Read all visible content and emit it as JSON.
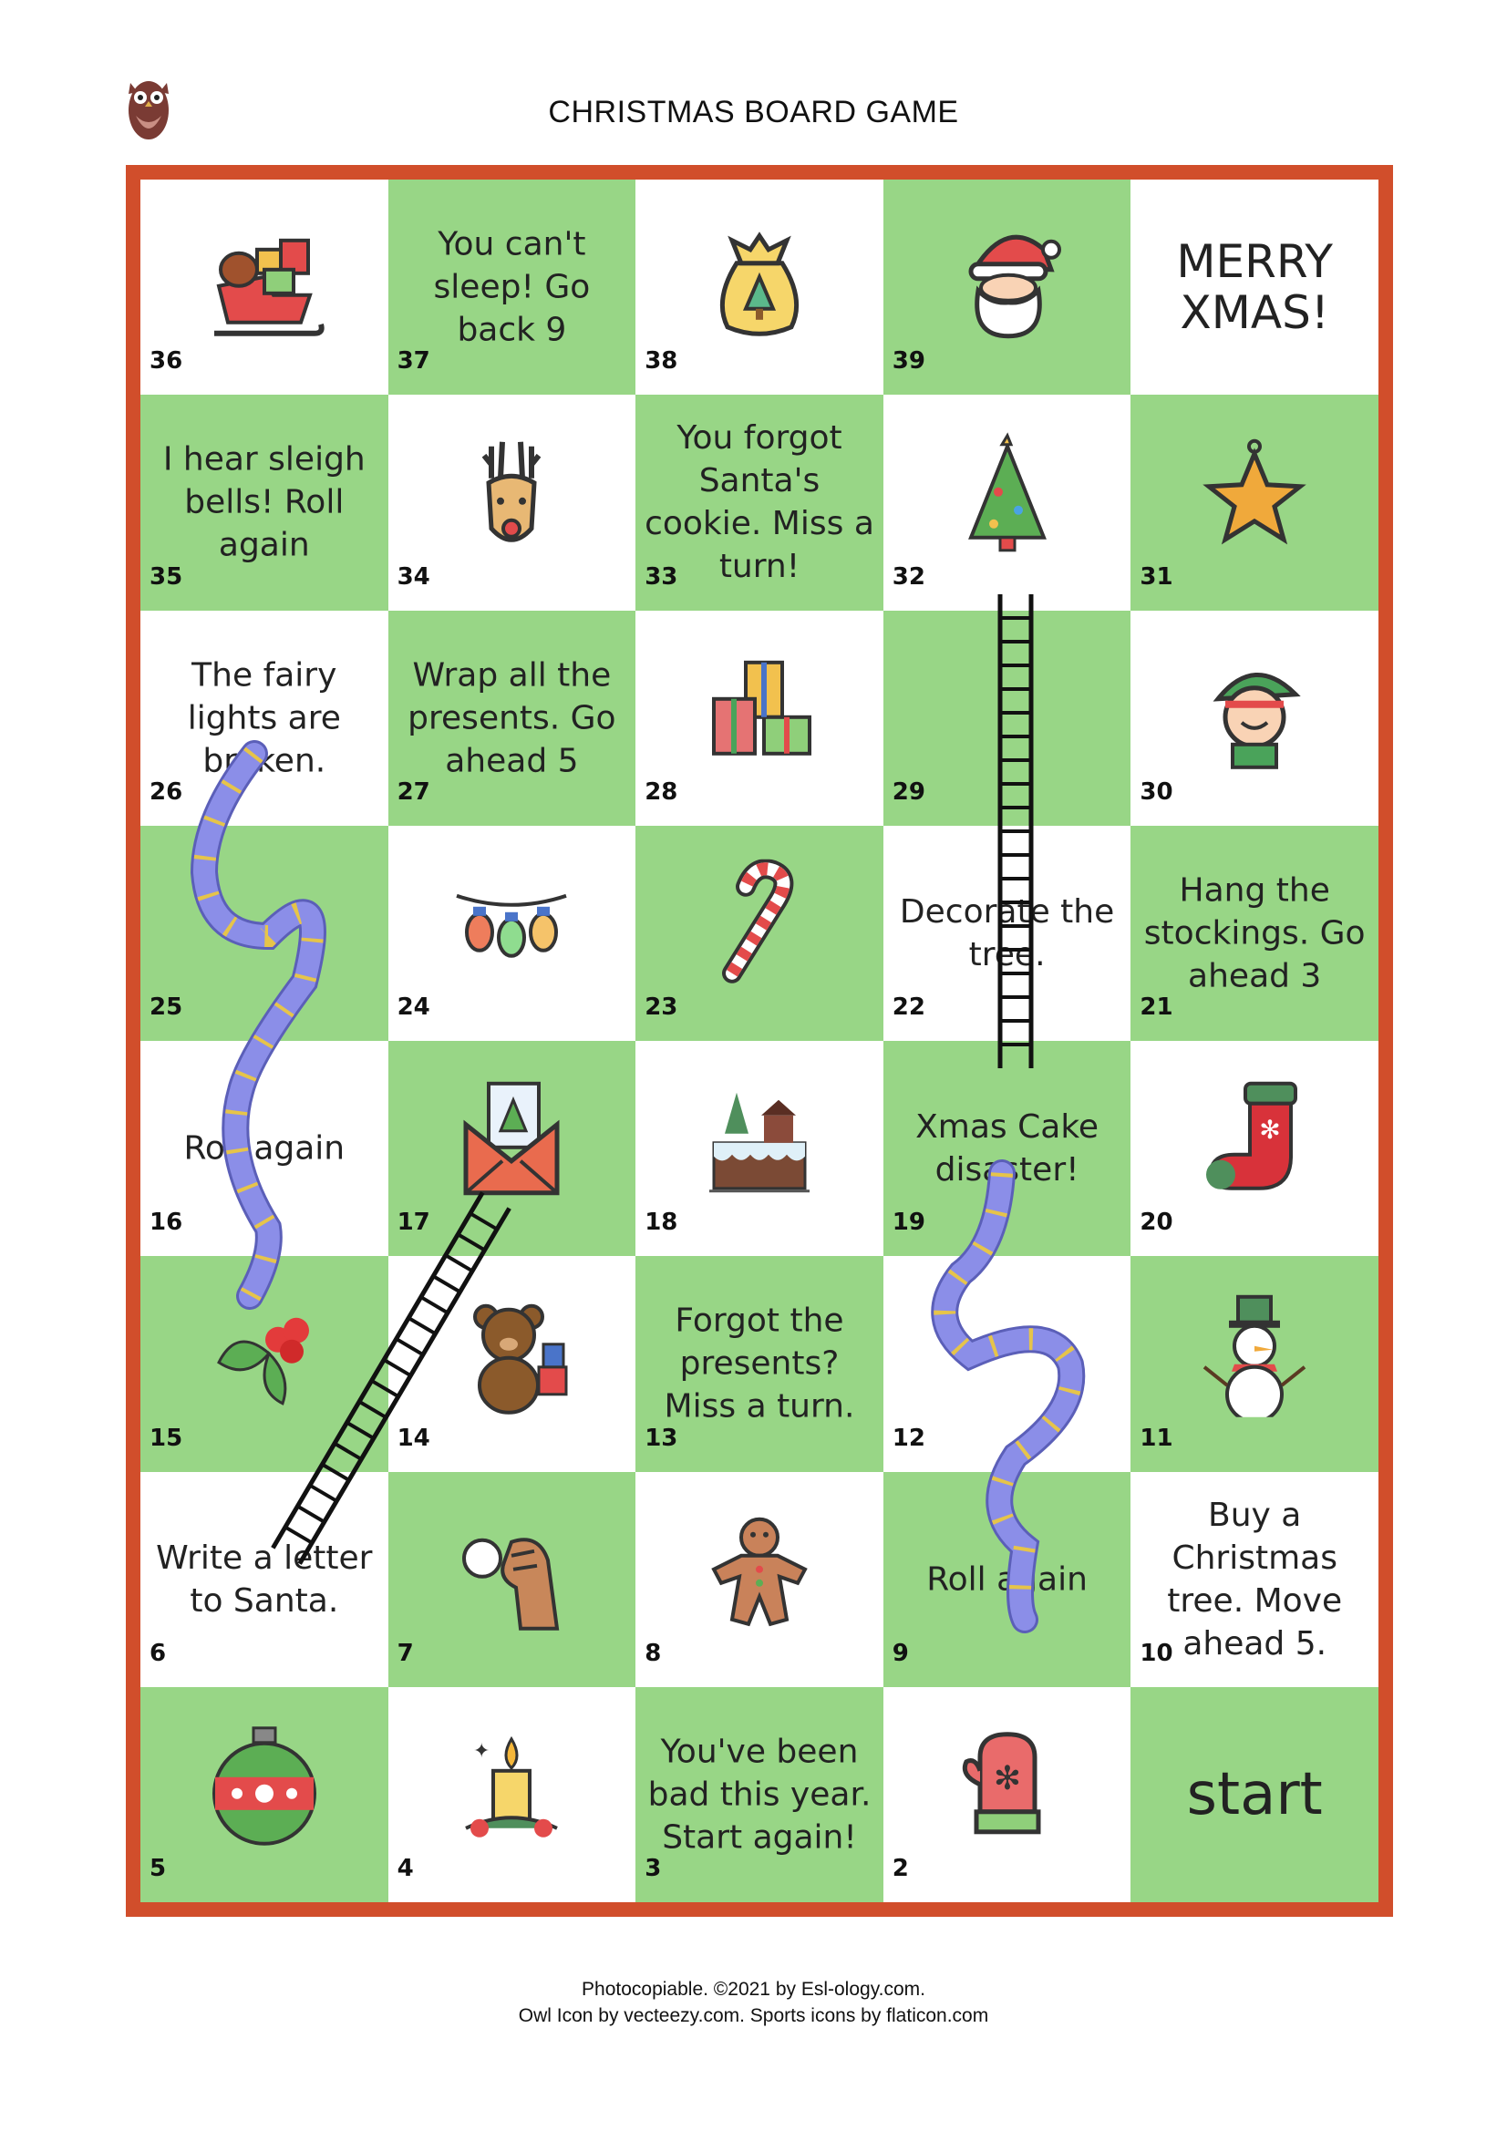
{
  "title": "CHRISTMAS BOARD GAME",
  "colors": {
    "border": "#d14e2b",
    "green": "#98d686",
    "white": "#ffffff",
    "snake": "#8b8ee8",
    "snake_stripe": "#e6c44a"
  },
  "board": {
    "rows": [
      [
        {
          "num": "36",
          "text": "",
          "icon": "sleigh-icon",
          "color": "white"
        },
        {
          "num": "37",
          "text": "You can't sleep! Go back 9",
          "icon": "",
          "color": "green"
        },
        {
          "num": "38",
          "text": "",
          "icon": "gift-sack-icon",
          "color": "white"
        },
        {
          "num": "39",
          "text": "",
          "icon": "santa-icon",
          "color": "green"
        },
        {
          "num": "",
          "text": "MERRY XMAS!",
          "icon": "",
          "color": "white"
        }
      ],
      [
        {
          "num": "35",
          "text": "I hear sleigh bells! Roll again",
          "icon": "",
          "color": "green"
        },
        {
          "num": "34",
          "text": "",
          "icon": "reindeer-icon",
          "color": "white"
        },
        {
          "num": "33",
          "text": "You forgot Santa's cookie. Miss a turn!",
          "icon": "",
          "color": "green"
        },
        {
          "num": "32",
          "text": "",
          "icon": "christmas-tree-icon",
          "color": "white"
        },
        {
          "num": "31",
          "text": "",
          "icon": "star-ornament-icon",
          "color": "green"
        }
      ],
      [
        {
          "num": "26",
          "text": "The fairy lights are broken.",
          "icon": "",
          "color": "white"
        },
        {
          "num": "27",
          "text": "Wrap all the presents. Go ahead 5",
          "icon": "",
          "color": "green"
        },
        {
          "num": "28",
          "text": "",
          "icon": "presents-icon",
          "color": "white"
        },
        {
          "num": "29",
          "text": "",
          "icon": "",
          "color": "green"
        },
        {
          "num": "30",
          "text": "",
          "icon": "elf-icon",
          "color": "white"
        }
      ],
      [
        {
          "num": "25",
          "text": "",
          "icon": "",
          "color": "green"
        },
        {
          "num": "24",
          "text": "",
          "icon": "fairy-lights-icon",
          "color": "white"
        },
        {
          "num": "23",
          "text": "",
          "icon": "candy-cane-icon",
          "color": "green"
        },
        {
          "num": "22",
          "text": "Decorate the tree.",
          "icon": "",
          "color": "white"
        },
        {
          "num": "21",
          "text": "Hang the stockings. Go ahead 3",
          "icon": "",
          "color": "green"
        }
      ],
      [
        {
          "num": "16",
          "text": "Roll again",
          "icon": "",
          "color": "white"
        },
        {
          "num": "17",
          "text": "",
          "icon": "christmas-card-icon",
          "color": "green"
        },
        {
          "num": "18",
          "text": "",
          "icon": "cake-icon",
          "color": "white"
        },
        {
          "num": "19",
          "text": "Xmas Cake disaster!",
          "icon": "",
          "color": "green"
        },
        {
          "num": "20",
          "text": "",
          "icon": "stocking-icon",
          "color": "white"
        }
      ],
      [
        {
          "num": "15",
          "text": "",
          "icon": "holly-icon",
          "color": "green"
        },
        {
          "num": "14",
          "text": "",
          "icon": "teddy-bear-icon",
          "color": "white"
        },
        {
          "num": "13",
          "text": "Forgot the presents? Miss a turn.",
          "icon": "",
          "color": "green"
        },
        {
          "num": "12",
          "text": "",
          "icon": "",
          "color": "white"
        },
        {
          "num": "11",
          "text": "",
          "icon": "snowman-icon",
          "color": "green"
        }
      ],
      [
        {
          "num": "6",
          "text": "Write a letter to Santa.",
          "icon": "",
          "color": "white"
        },
        {
          "num": "7",
          "text": "",
          "icon": "snowball-icon",
          "color": "green"
        },
        {
          "num": "8",
          "text": "",
          "icon": "gingerbread-icon",
          "color": "white"
        },
        {
          "num": "9",
          "text": "Roll again",
          "icon": "",
          "color": "green"
        },
        {
          "num": "10",
          "text": "Buy a Christmas tree. Move ahead 5.",
          "icon": "",
          "color": "white"
        }
      ],
      [
        {
          "num": "5",
          "text": "",
          "icon": "bauble-icon",
          "color": "green"
        },
        {
          "num": "4",
          "text": "",
          "icon": "candle-icon",
          "color": "white"
        },
        {
          "num": "3",
          "text": "You've been bad this year. Start again!",
          "icon": "",
          "color": "green"
        },
        {
          "num": "2",
          "text": "",
          "icon": "mitten-icon",
          "color": "white"
        },
        {
          "num": "",
          "text": "start",
          "icon": "",
          "color": "green"
        }
      ]
    ]
  },
  "footer": {
    "line1": "Photocopiable. ©2021 by Esl-ology.com.",
    "line2": "Owl Icon by vecteezy.com. Sports icons by flaticon.com"
  }
}
